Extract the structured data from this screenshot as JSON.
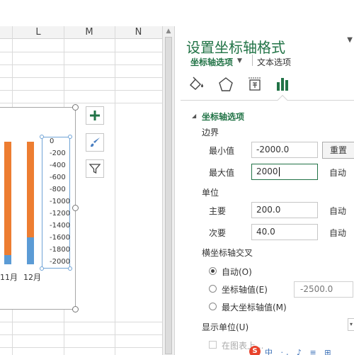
{
  "sheet": {
    "columns": [
      "L",
      "M",
      "N"
    ],
    "chart_data": {
      "type": "bar",
      "categories": [
        "11月",
        "12月"
      ],
      "y_ticks": [
        "0",
        "-200",
        "-400",
        "-600",
        "-800",
        "-1000",
        "-1200",
        "-1400",
        "-1600",
        "-1800",
        "-2000"
      ],
      "ylim": [
        -2000,
        0
      ],
      "series_colors": [
        "#ed7d31",
        "#5b9bd5"
      ]
    },
    "chart_buttons": [
      "plus-icon",
      "brush-icon",
      "filter-icon"
    ]
  },
  "pane": {
    "title": "设置坐标轴格式",
    "tab_axis_options": "坐标轴选项",
    "tab_text_options": "文本选项",
    "section_title": "坐标轴选项",
    "bounds": {
      "heading": "边界",
      "min_label": "最小值",
      "min_value": "-2000.0",
      "reset_label": "重置",
      "max_label": "最大值",
      "max_value": "2000",
      "max_auto": "自动"
    },
    "units": {
      "heading": "单位",
      "major_label": "主要",
      "major_value": "200.0",
      "major_auto": "自动",
      "minor_label": "次要",
      "minor_value": "40.0",
      "minor_auto": "自动"
    },
    "cross": {
      "heading": "横坐标轴交叉",
      "opt_auto": "自动(O)",
      "opt_value": "坐标轴值(E)",
      "value": "-2500.0",
      "opt_max": "最大坐标轴值(M)"
    },
    "display_unit": {
      "heading": "显示单位(U)",
      "checkbox_label": "在图表上..."
    }
  },
  "ime": {
    "logo": "S",
    "text": "中 ·, ♪ ≡ ⊞"
  }
}
